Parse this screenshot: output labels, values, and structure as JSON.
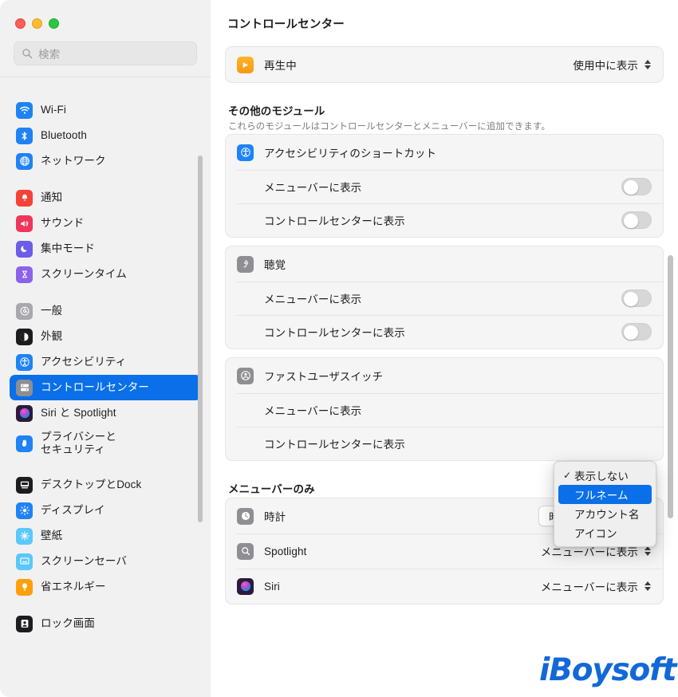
{
  "window": {
    "traffic_lights": [
      "close",
      "minimize",
      "maximize"
    ]
  },
  "search": {
    "placeholder": "検索",
    "icon": "search-icon"
  },
  "sidebar": {
    "groups": [
      {
        "items": [
          {
            "label": "Wi-Fi",
            "icon": "wifi-icon",
            "color": "#1f82f5"
          },
          {
            "label": "Bluetooth",
            "icon": "bluetooth-icon",
            "color": "#1f82f5"
          },
          {
            "label": "ネットワーク",
            "icon": "network-globe-icon",
            "color": "#1f82f5"
          }
        ]
      },
      {
        "items": [
          {
            "label": "通知",
            "icon": "notifications-icon",
            "color": "#f44336"
          },
          {
            "label": "サウンド",
            "icon": "sound-icon",
            "color": "#f0365b"
          },
          {
            "label": "集中モード",
            "icon": "focus-moon-icon",
            "color": "#6c5ce7"
          },
          {
            "label": "スクリーンタイム",
            "icon": "screentime-hourglass-icon",
            "color": "#8a63e8"
          }
        ]
      },
      {
        "items": [
          {
            "label": "一般",
            "icon": "general-gear-icon",
            "color": "#a8a8ad"
          },
          {
            "label": "外観",
            "icon": "appearance-icon",
            "color": "#1c1c1e"
          },
          {
            "label": "アクセシビリティ",
            "icon": "accessibility-icon",
            "color": "#1f82f5"
          },
          {
            "label": "コントロールセンター",
            "icon": "control-center-icon",
            "color": "#8e8e93",
            "selected": true
          },
          {
            "label": "Siri と Spotlight",
            "icon": "siri-icon",
            "color": "#2b1a3c"
          },
          {
            "label": "プライバシーと\nセキュリティ",
            "icon": "privacy-hand-icon",
            "color": "#1f82f5",
            "two_line": true
          }
        ]
      },
      {
        "items": [
          {
            "label": "デスクトップとDock",
            "icon": "desktop-dock-icon",
            "color": "#1c1c1e"
          },
          {
            "label": "ディスプレイ",
            "icon": "display-icon",
            "color": "#1f82f5"
          },
          {
            "label": "壁紙",
            "icon": "wallpaper-icon",
            "color": "#5ac8fa"
          },
          {
            "label": "スクリーンセーバ",
            "icon": "screensaver-icon",
            "color": "#5ac8fa"
          },
          {
            "label": "省エネルギー",
            "icon": "energy-saver-icon",
            "color": "#ff9f0a"
          }
        ]
      },
      {
        "items": [
          {
            "label": "ロック画面",
            "icon": "lock-screen-icon",
            "color": "#1c1c1e"
          }
        ]
      }
    ]
  },
  "header": {
    "title": "コントロールセンター"
  },
  "main": {
    "now_playing": {
      "label": "再生中",
      "icon": "now-playing-icon",
      "value": "使用中に表示"
    },
    "other_modules": {
      "title": "その他のモジュール",
      "subtitle": "これらのモジュールはコントロールセンターとメニューバーに追加できます。",
      "modules": [
        {
          "label": "アクセシビリティのショートカット",
          "icon": "accessibility-icon",
          "icon_color": "#1f82f5",
          "options": [
            {
              "label": "メニューバーに表示",
              "toggle": "off"
            },
            {
              "label": "コントロールセンターに表示",
              "toggle": "off"
            }
          ]
        },
        {
          "label": "聴覚",
          "icon": "hearing-ear-icon",
          "icon_color": "#8e8e93",
          "options": [
            {
              "label": "メニューバーに表示",
              "toggle": "off"
            },
            {
              "label": "コントロールセンターに表示",
              "toggle": "off"
            }
          ]
        },
        {
          "label": "ファストユーザスイッチ",
          "icon": "fast-user-switch-icon",
          "icon_color": "#8e8e93",
          "options": [
            {
              "label": "メニューバーに表示",
              "toggle": "hidden"
            },
            {
              "label": "コントロールセンターに表示",
              "toggle": "hidden"
            }
          ]
        }
      ]
    },
    "menu_bar_only": {
      "title": "メニューバーのみ",
      "rows": [
        {
          "label": "時計",
          "icon": "clock-icon",
          "icon_color": "#8e8e93",
          "control": "button",
          "value": "時計のオプション..."
        },
        {
          "label": "Spotlight",
          "icon": "spotlight-search-icon",
          "icon_color": "#8e8e93",
          "control": "popup",
          "value": "メニューバーに表示"
        },
        {
          "label": "Siri",
          "icon": "siri-icon",
          "icon_color": "#2b1a3c",
          "control": "popup",
          "value": "メニューバーに表示"
        }
      ]
    }
  },
  "dropdown": {
    "items": [
      {
        "label": "表示しない",
        "checked": true,
        "highlighted": false
      },
      {
        "label": "フルネーム",
        "checked": false,
        "highlighted": true
      },
      {
        "label": "アカウント名",
        "checked": false,
        "highlighted": false
      },
      {
        "label": "アイコン",
        "checked": false,
        "highlighted": false
      }
    ]
  },
  "watermark": {
    "text": "iBoysoft",
    "color": "#1268d8"
  },
  "colors": {
    "accent": "#0a6fe8",
    "sidebar_bg": "#f2f1f2",
    "card_bg": "#f5f5f5"
  }
}
